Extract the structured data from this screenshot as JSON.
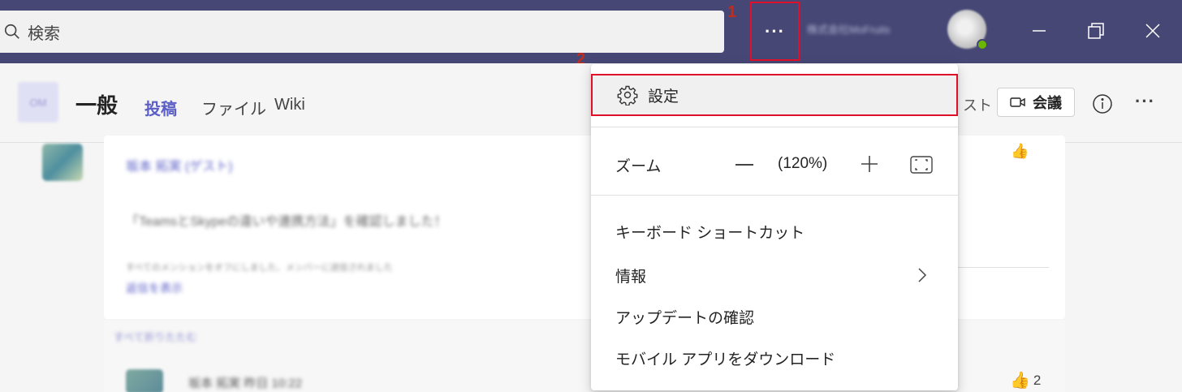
{
  "titlebar": {
    "search_placeholder": "検索",
    "more_label": "···",
    "org_name": "株式会社MoFruits",
    "callout_1": "1",
    "callout_2": "2"
  },
  "channel": {
    "team_initials": "OM",
    "name": "一般",
    "tabs": [
      {
        "label": "投稿",
        "active": true
      },
      {
        "label": "ファイル",
        "active": false
      },
      {
        "label": "Wiki",
        "active": false
      }
    ],
    "partial_button": "スト",
    "meet_label": "会議",
    "more_label": "···"
  },
  "feed": {
    "author": "坂本 拓実 (ゲスト)",
    "message": "「TeamsとSkypeの違いや連携方法」を確認しました！",
    "meta": "すべてのメンションをオフにしました、メンバーに送信されました",
    "reply_link": "返信を表示",
    "collapse": "すべて折りたたむ",
    "reply_author": "坂本 拓実  昨日 10:22",
    "like_count": "2"
  },
  "menu": {
    "settings": "設定",
    "zoom_label": "ズーム",
    "zoom_value": "(120%)",
    "shortcuts": "キーボード ショートカット",
    "info": "情報",
    "check_updates": "アップデートの確認",
    "download_mobile": "モバイル アプリをダウンロード"
  },
  "colors": {
    "titlebar": "#464775",
    "accent": "#5b5fc7",
    "highlight_border": "#e0102a"
  }
}
